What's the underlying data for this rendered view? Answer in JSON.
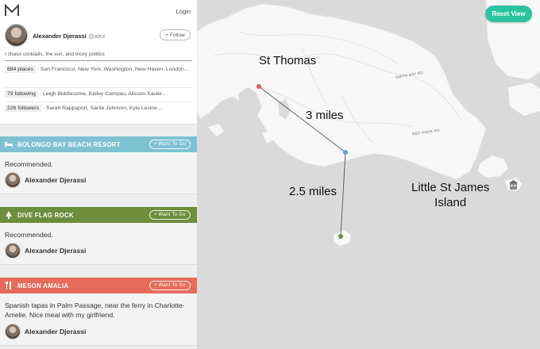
{
  "header": {
    "login": "Login"
  },
  "profile": {
    "name": "Alexander Djerassi",
    "handle": "@alex",
    "follow_label": "+ Follow",
    "bio": "I chase cocktails, the sun, and tricky politics",
    "places_count": "684 places",
    "places_list": "· San Francisco, New York, Washington, New Haven, London…",
    "following_count": "79 following",
    "following_list": "· Leigh Biddlecome, Kelley Campau, Alisson Xavier…",
    "followers_count": "226 followers",
    "followers_list": "· Sarah Rappaport, Sante Johnson, Kyle Levine…"
  },
  "cards": [
    {
      "title": "BOLONGO BAY BEACH RESORT",
      "icon": "bed-icon",
      "color": "#7ec2d2",
      "want_label": "+ Want To Go",
      "description": "Recommended.",
      "recommender": "Alexander Djerassi"
    },
    {
      "title": "DIVE FLAG ROCK",
      "icon": "tree-icon",
      "color": "#6d8e3d",
      "want_label": "+ Want To Go",
      "description": "Recommended.",
      "recommender": "Alexander Djerassi"
    },
    {
      "title": "MESON AMALIA",
      "icon": "fork-knife-icon",
      "color": "#e56b5b",
      "want_label": "+ Want To Go",
      "description": "Spanish tapas in Palm Passage, near the ferry in Charlotte-Amelie. Nice meal with my girlfriend.",
      "recommender": "Alexander Djerassi"
    }
  ],
  "map": {
    "reset_label": "Reset View",
    "labels": {
      "st_thomas": "St Thomas",
      "three_miles": "3 miles",
      "two_half_miles": "2.5 miles",
      "little_st_james": "Little St James\nIsland"
    },
    "roads": [
      "SMITH BAY RD",
      "RED HOOK RD"
    ],
    "marker_colors": [
      "#e8574a",
      "#5aa7c4",
      "#6d8e3d"
    ]
  }
}
